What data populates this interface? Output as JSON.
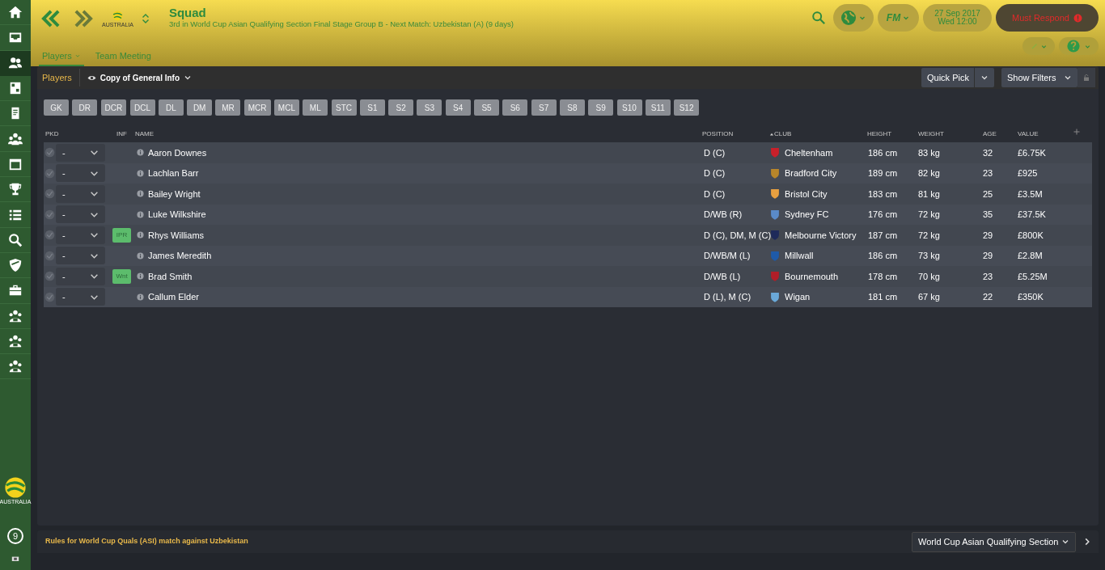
{
  "sidebar": {
    "items": [
      {
        "kind": "home",
        "selected": false
      },
      {
        "kind": "inbox",
        "selected": false
      },
      {
        "kind": "people",
        "selected": true
      },
      {
        "kind": "board",
        "selected": false
      },
      {
        "kind": "document",
        "selected": false
      },
      {
        "kind": "group",
        "selected": false
      },
      {
        "kind": "calendar",
        "selected": false
      },
      {
        "kind": "trophy",
        "selected": false
      },
      {
        "kind": "list",
        "selected": false
      },
      {
        "kind": "search",
        "selected": false
      },
      {
        "kind": "shield",
        "selected": false
      },
      {
        "kind": "briefcase",
        "selected": false
      },
      {
        "kind": "team",
        "selected": false
      },
      {
        "kind": "team",
        "selected": false
      },
      {
        "kind": "team",
        "selected": false
      }
    ],
    "logo_text": "AUSTRALIA",
    "badge": "9"
  },
  "header": {
    "title": "Squad",
    "subtitle": "3rd in World Cup Asian Qualifying Section Final Stage Group B - Next Match: Uzbekistan (A) (9 days)",
    "logo_text": "AUSTRALIA",
    "date": "27 Sep 2017",
    "time": "Wed 12:00",
    "alert": "Must Respond",
    "fm_label": "FM"
  },
  "tabs": [
    {
      "label": "Players",
      "selected": true,
      "dropdown": true
    },
    {
      "label": "Team Meeting",
      "selected": false,
      "dropdown": false
    }
  ],
  "toolbar": {
    "title": "Players",
    "view": "Copy of General Info",
    "quick_pick": "Quick Pick",
    "filters": "Show Filters"
  },
  "position_buttons": [
    "GK",
    "DR",
    "DCR",
    "DCL",
    "DL",
    "DM",
    "MR",
    "MCR",
    "MCL",
    "ML",
    "STC",
    "S1",
    "S2",
    "S3",
    "S4",
    "S5",
    "S6",
    "S7",
    "S8",
    "S9",
    "S10",
    "S11",
    "S12"
  ],
  "table": {
    "columns": [
      {
        "label": "PKD",
        "sorted": false
      },
      {
        "label": "INF",
        "sorted": false
      },
      {
        "label": "NAME",
        "sorted": false
      },
      {
        "label": "POSITION",
        "sorted": false
      },
      {
        "label": "CLUB",
        "sorted": true
      },
      {
        "label": "HEIGHT",
        "sorted": false
      },
      {
        "label": "WEIGHT",
        "sorted": false
      },
      {
        "label": "AGE",
        "sorted": false
      },
      {
        "label": "VALUE",
        "sorted": false
      }
    ],
    "rows": [
      {
        "pick": "-",
        "inf": "",
        "name": "Aaron Downes",
        "position": "D (C)",
        "club": "Cheltenham",
        "color": "#c8202a",
        "height": "186 cm",
        "weight": "83 kg",
        "age": "32",
        "value": "£6.75K"
      },
      {
        "pick": "-",
        "inf": "",
        "name": "Lachlan Barr",
        "position": "D (C)",
        "club": "Bradford City",
        "color": "#b8862a",
        "height": "189 cm",
        "weight": "82 kg",
        "age": "23",
        "value": "£925"
      },
      {
        "pick": "-",
        "inf": "",
        "name": "Bailey Wright",
        "position": "D (C)",
        "club": "Bristol City",
        "color": "#e8a040",
        "height": "183 cm",
        "weight": "81 kg",
        "age": "25",
        "value": "£3.5M"
      },
      {
        "pick": "-",
        "inf": "",
        "name": "Luke Wilkshire",
        "position": "D/WB (R)",
        "club": "Sydney FC",
        "color": "#5a8ac8",
        "height": "176 cm",
        "weight": "72 kg",
        "age": "35",
        "value": "£37.5K"
      },
      {
        "pick": "-",
        "inf": "IPR",
        "name": "Rhys Williams",
        "position": "D (C), DM, M (C)",
        "club": "Melbourne Victory",
        "color": "#1e2a5a",
        "height": "187 cm",
        "weight": "72 kg",
        "age": "29",
        "value": "£800K"
      },
      {
        "pick": "-",
        "inf": "",
        "name": "James Meredith",
        "position": "D/WB/M (L)",
        "club": "Millwall",
        "color": "#1e5aa8",
        "height": "186 cm",
        "weight": "73 kg",
        "age": "29",
        "value": "£2.8M"
      },
      {
        "pick": "-",
        "inf": "Wnt",
        "name": "Brad Smith",
        "position": "D/WB (L)",
        "club": "Bournemouth",
        "color": "#b01e28",
        "height": "178 cm",
        "weight": "70 kg",
        "age": "23",
        "value": "£5.25M"
      },
      {
        "pick": "-",
        "inf": "",
        "name": "Callum Elder",
        "position": "D (L), M (C)",
        "club": "Wigan",
        "color": "#6aa8d8",
        "height": "181 cm",
        "weight": "67 kg",
        "age": "22",
        "value": "£350K"
      }
    ]
  },
  "footer": {
    "rules": "Rules for World Cup Quals (ASI) match against Uzbekistan",
    "competition": "World Cup Asian Qualifying Section"
  }
}
